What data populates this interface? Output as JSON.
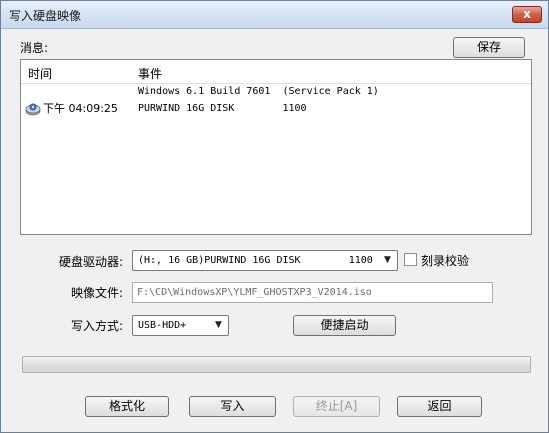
{
  "window": {
    "title": "写入硬盘映像",
    "close_glyph": "x"
  },
  "messages": {
    "label": "消息:",
    "save_button": "保存",
    "columns": {
      "time": "时间",
      "event": "事件"
    },
    "rows": [
      {
        "time": "",
        "event": "Windows 6.1 Build 7601  (Service Pack 1)",
        "icon": ""
      },
      {
        "time": "下午 04:09:25",
        "event": "PURWIND 16G DISK        1100",
        "icon": "disk-icon"
      }
    ]
  },
  "drive": {
    "label": "硬盘驱动器:",
    "value": "(H:, 16 GB)PURWIND 16G DISK        1100",
    "verify_label": "刻录校验",
    "verify_checked": false
  },
  "image_file": {
    "label": "映像文件:",
    "value": "F:\\CD\\WindowsXP\\YLMF_GHOSTXP3_V2014.iso"
  },
  "write_mode": {
    "label": "写入方式:",
    "value": "USB-HDD+",
    "quick_boot_button": "便捷启动"
  },
  "progress": {
    "percent": 0
  },
  "buttons": {
    "format": "格式化",
    "write": "写入",
    "abort": "终止[A]",
    "back": "返回"
  },
  "colors": {
    "accent": "#06b025",
    "title_bar": "#d4e2f3",
    "close_button": "#cf6048"
  }
}
